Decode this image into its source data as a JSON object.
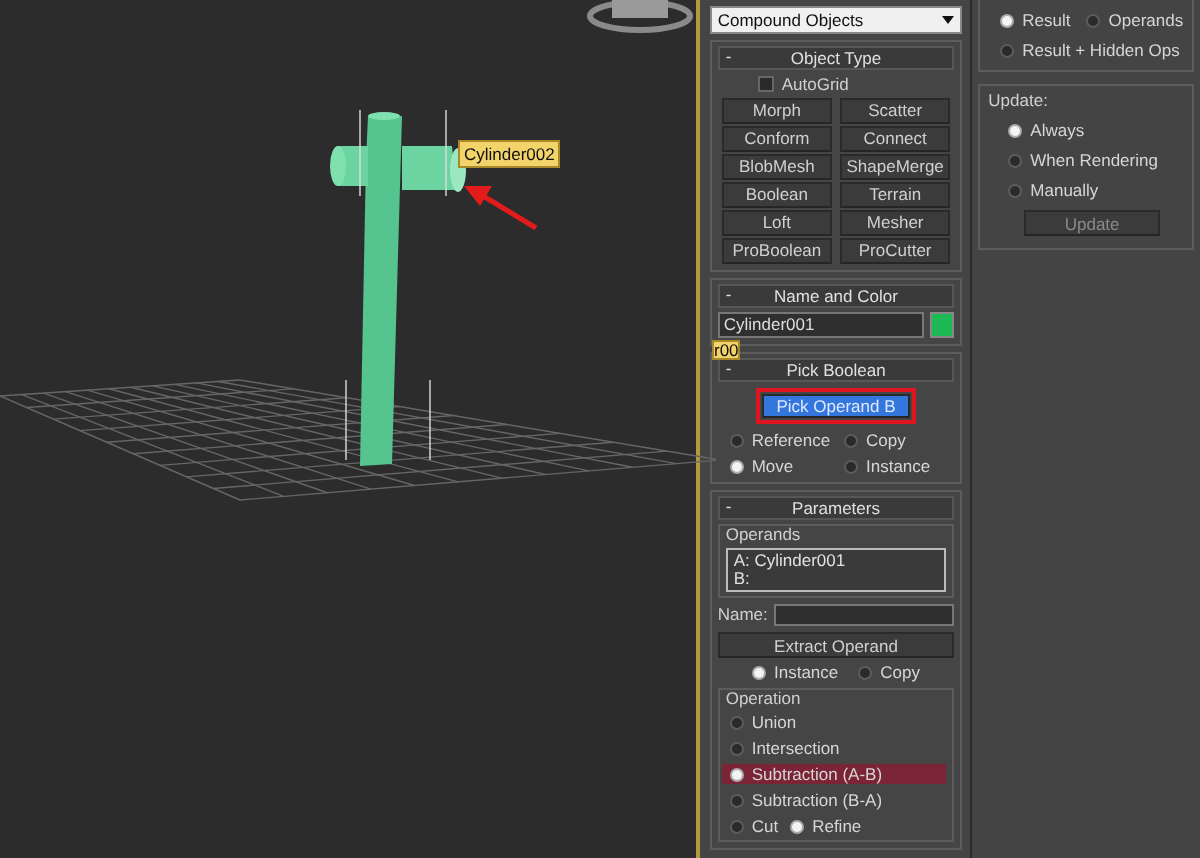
{
  "viewport": {
    "object_label": "Cylinder002",
    "clipped_label": "r00"
  },
  "command_panel": {
    "category_dropdown": "Compound Objects",
    "object_type": {
      "title": "Object Type",
      "toggle": "-",
      "autogrid": {
        "label": "AutoGrid",
        "checked": false
      },
      "buttons": [
        "Morph",
        "Scatter",
        "Conform",
        "Connect",
        "BlobMesh",
        "ShapeMerge",
        "Boolean",
        "Terrain",
        "Loft",
        "Mesher",
        "ProBoolean",
        "ProCutter"
      ]
    },
    "name_and_color": {
      "title": "Name and Color",
      "toggle": "-",
      "name": "Cylinder001",
      "color": "#1db954"
    },
    "pick_boolean": {
      "title": "Pick Boolean",
      "toggle": "-",
      "button": {
        "label": "Pick Operand B",
        "highlighted": true
      },
      "options": [
        {
          "label": "Reference",
          "selected": false
        },
        {
          "label": "Copy",
          "selected": false
        },
        {
          "label": "Move",
          "selected": true
        },
        {
          "label": "Instance",
          "selected": false
        }
      ]
    },
    "parameters": {
      "title": "Parameters",
      "toggle": "-",
      "operands_label": "Operands",
      "operands": [
        "A: Cylinder001",
        "B:"
      ],
      "name_label": "Name:",
      "extract_button": "Extract Operand",
      "extract_options": [
        {
          "label": "Instance",
          "selected": true
        },
        {
          "label": "Copy",
          "selected": false
        }
      ],
      "operation_label": "Operation",
      "operations": [
        {
          "label": "Union",
          "selected": false,
          "highlighted": false
        },
        {
          "label": "Intersection",
          "selected": false,
          "highlighted": false
        },
        {
          "label": "Subtraction (A-B)",
          "selected": true,
          "highlighted": true
        },
        {
          "label": "Subtraction (B-A)",
          "selected": false,
          "highlighted": false
        },
        {
          "label": "Cut",
          "selected": false,
          "highlighted": false
        }
      ],
      "cut_mode": [
        {
          "label": "Refine",
          "selected": true
        }
      ]
    }
  },
  "side_panel": {
    "display_options": [
      {
        "label": "Result",
        "selected": true
      },
      {
        "label": "Operands",
        "selected": false
      },
      {
        "label": "Result + Hidden Ops",
        "selected": false
      }
    ],
    "update_label": "Update:",
    "update_options": [
      {
        "label": "Always",
        "selected": true
      },
      {
        "label": "When Rendering",
        "selected": false
      },
      {
        "label": "Manually",
        "selected": false
      }
    ],
    "update_button": "Update"
  }
}
